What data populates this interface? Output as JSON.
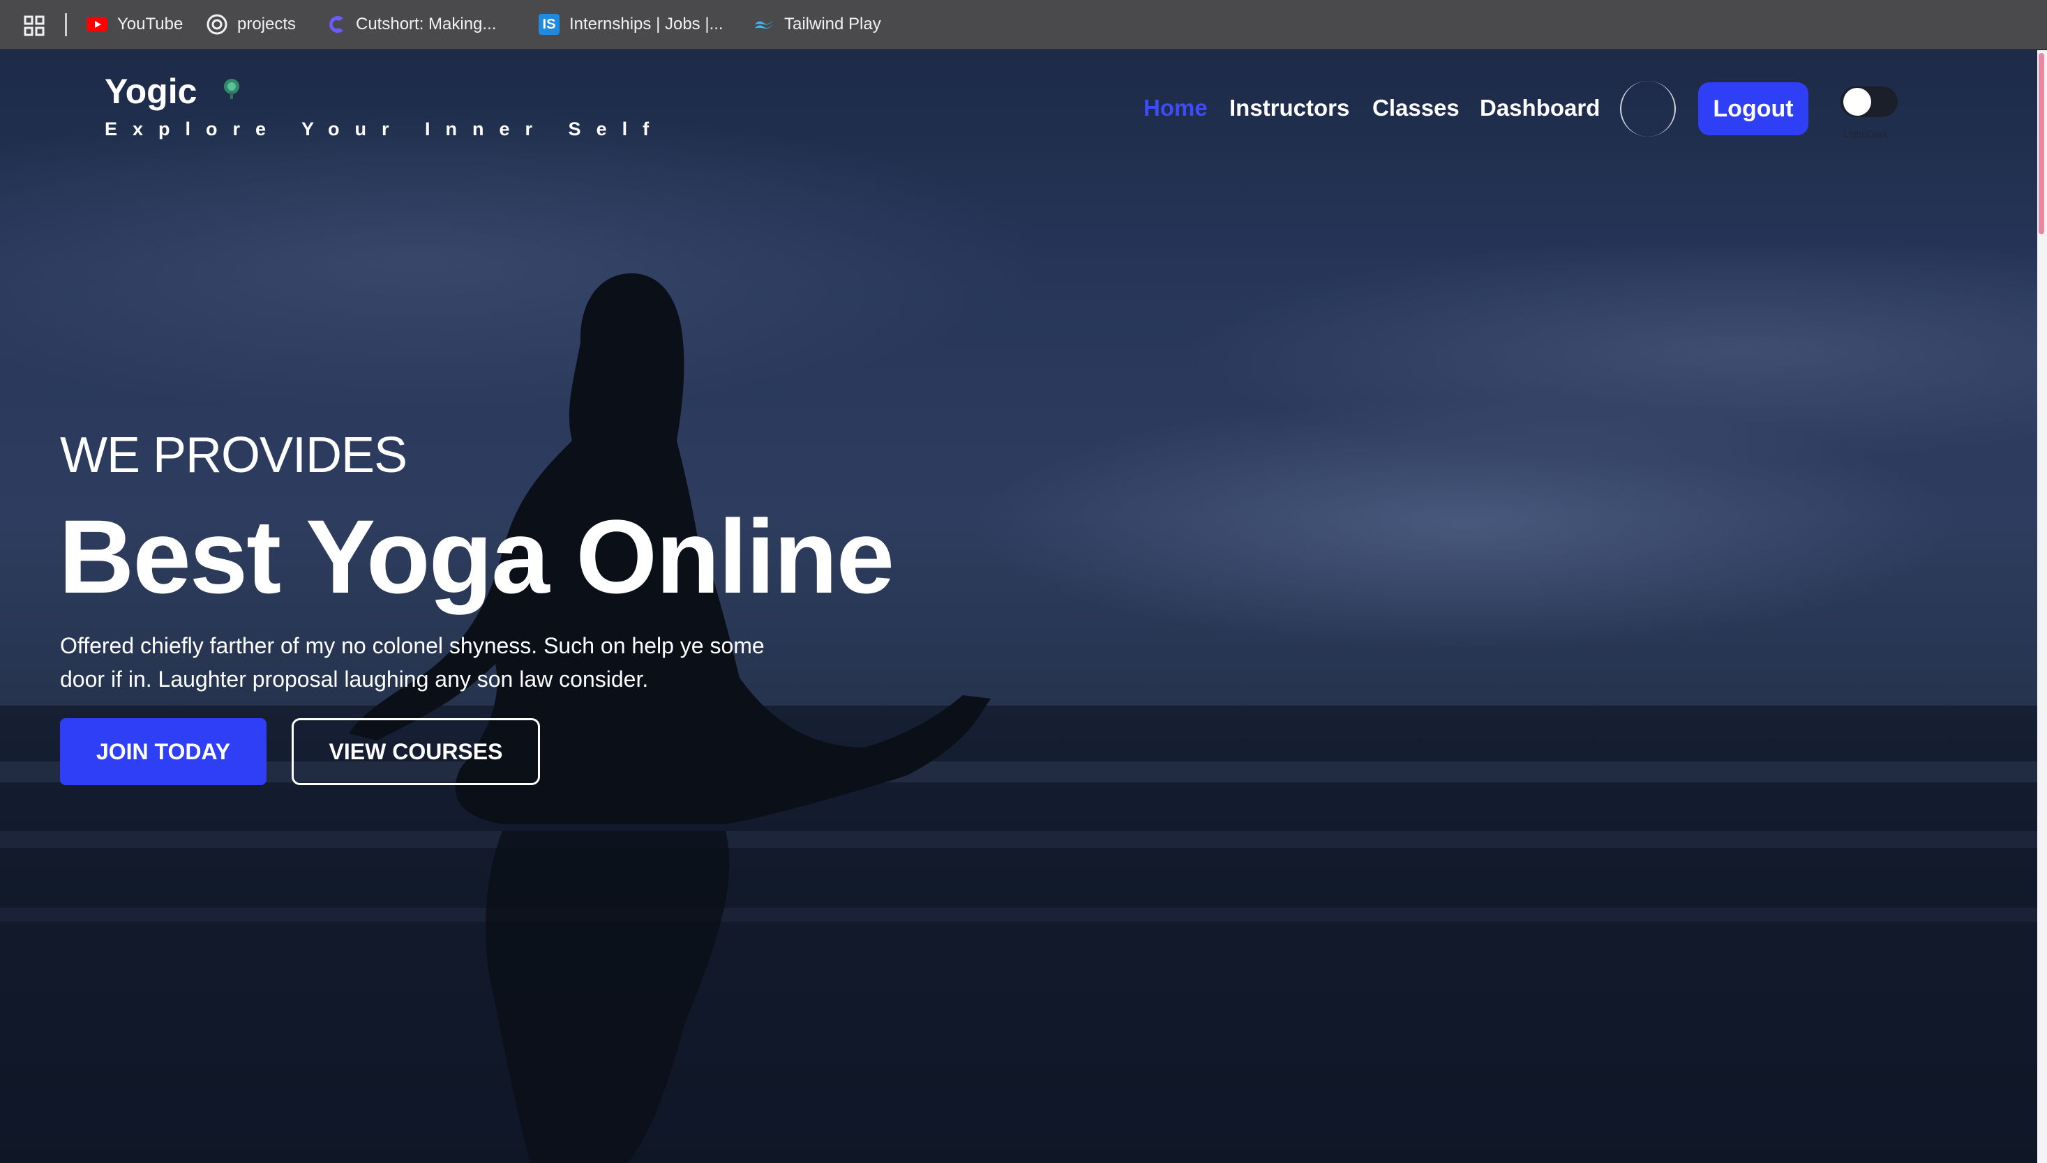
{
  "bookmarks": [
    {
      "label": "YouTube",
      "icon": "youtube-icon"
    },
    {
      "label": "projects",
      "icon": "openai-icon"
    },
    {
      "label": "Cutshort: Making...",
      "icon": "cutshort-icon"
    },
    {
      "label": "Internships | Jobs |...",
      "icon": "internshala-icon",
      "icon_text": "IS"
    },
    {
      "label": "Tailwind Play",
      "icon": "tailwind-icon"
    }
  ],
  "brand": {
    "title": "Yogic",
    "tagline": "Explore Your Inner Self"
  },
  "nav": {
    "items": [
      "Home",
      "Instructors",
      "Classes",
      "Dashboard"
    ],
    "active": "Home",
    "logout_label": "Logout",
    "theme_toggle_label": "Light/Dark"
  },
  "hero": {
    "eyebrow": "WE PROVIDES",
    "title": "Best Yoga Online",
    "body": "Offered chiefly farther of my no colonel shyness. Such on help ye some door if in. Laughter proposal laughing any son law consider.",
    "primary_cta": "JOIN TODAY",
    "secondary_cta": "VIEW COURSES"
  },
  "colors": {
    "accent": "#2f3ff5",
    "nav_active": "#3d4cf5",
    "bookmarks_bar": "#4a4a4c",
    "youtube_red": "#ff0000",
    "internshala_blue": "#1f8be0",
    "tailwind_cyan": "#38bdf8",
    "cutshort_purple": "#6a5cff"
  }
}
